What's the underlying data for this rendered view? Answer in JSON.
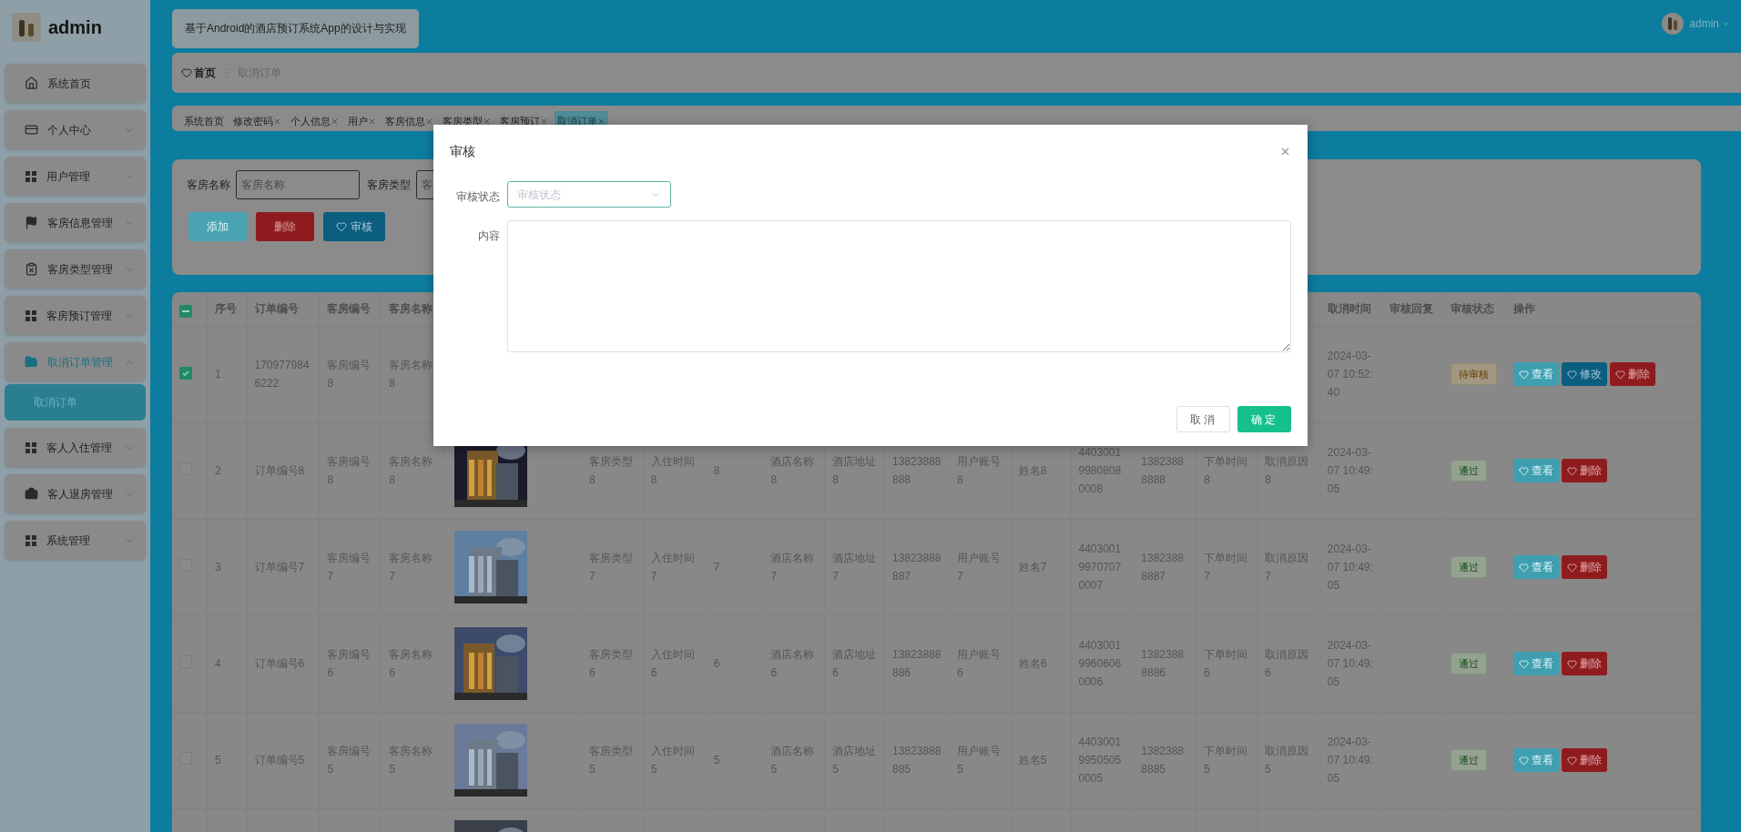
{
  "sidebar": {
    "title": "admin",
    "items": [
      {
        "label": "系统首页",
        "selected": false
      },
      {
        "label": "个人中心",
        "expanded": false,
        "selected": false
      },
      {
        "label": "用户管理",
        "expanded": false,
        "selected": false
      },
      {
        "label": "客房信息管理",
        "expanded": false,
        "selected": false
      },
      {
        "label": "客房类型管理",
        "expanded": false,
        "selected": false
      },
      {
        "label": "客房预订管理",
        "expanded": false,
        "selected": false
      },
      {
        "label": "取消订单管理",
        "expanded": true,
        "selected": true,
        "children": [
          {
            "label": "取消订单",
            "selected": true
          }
        ]
      },
      {
        "label": "客人入住管理",
        "expanded": false,
        "selected": false
      },
      {
        "label": "客人退房管理",
        "expanded": false,
        "selected": false
      },
      {
        "label": "系统管理",
        "expanded": false,
        "selected": false
      }
    ]
  },
  "header": {
    "title": "基于Android的酒店预订系统App的设计与实现",
    "user": "admin"
  },
  "breadcrumb": [
    "首页",
    "取消订单"
  ],
  "tabs": [
    {
      "label": "系统首页",
      "closable": false,
      "selected": false
    },
    {
      "label": "修改密码",
      "closable": true,
      "selected": false
    },
    {
      "label": "个人信息",
      "closable": true,
      "selected": false
    },
    {
      "label": "用户",
      "closable": true,
      "selected": false
    },
    {
      "label": "客房信息",
      "closable": true,
      "selected": false
    },
    {
      "label": "客房类型",
      "closable": true,
      "selected": false
    },
    {
      "label": "客房预订",
      "closable": true,
      "selected": false
    },
    {
      "label": "取消订单",
      "closable": true,
      "selected": true
    }
  ],
  "search": {
    "fields": [
      {
        "label": "客房名称",
        "placeholder": "客房名称"
      },
      {
        "label": "客房类型",
        "placeholder": "客"
      }
    ]
  },
  "toolbar": [
    {
      "label": "添加",
      "kind": "add"
    },
    {
      "label": "删除",
      "kind": "delete"
    },
    {
      "label": "审核",
      "kind": "review"
    }
  ],
  "table": {
    "select_all": {
      "indeterminate": true
    },
    "columns": {
      "index": "序号",
      "order_no": "订单编号",
      "room_no": "客房编号",
      "room_name": "客房名称",
      "cancel_time": "取消时间",
      "review_reply": "审核回复",
      "review_status": "审核状态",
      "actions": "操作"
    },
    "rows": [
      {
        "checked": true,
        "index": "1",
        "order_no": "1709779846222",
        "room_no": "客房编号8",
        "room_name": "客房名称8",
        "cancel_time": "2024-03-07 10:52:40",
        "status": {
          "label": "待审核",
          "kind": "pending"
        },
        "actions": [
          {
            "label": "查看",
            "kind": "view"
          },
          {
            "label": "修改",
            "kind": "edit"
          },
          {
            "label": "删除",
            "kind": "delete"
          }
        ]
      },
      {
        "checked": false,
        "index": "2",
        "order_no": "订单编号8",
        "room_no": "客房编号8",
        "room_name": "客房名称8",
        "photo": {
          "kind": "picture"
        },
        "room_type": "客房类型8",
        "checkin_time": "入住时间8",
        "column_8": "8",
        "hotel_name": "酒店名称8",
        "hotel_address": "酒店地址8",
        "phone": "13823888888",
        "user_account": "用户账号8",
        "name": "姓名8",
        "id_number": "440300199808080008",
        "user_phone": "13823888888",
        "order_time": "下单时间8",
        "cancel_reason": "取消原因8",
        "cancel_time": "2024-03-07 10:49:05",
        "status": {
          "label": "通过",
          "kind": "passed"
        },
        "actions": [
          {
            "label": "查看",
            "kind": "view"
          },
          {
            "label": "删除",
            "kind": "delete"
          }
        ]
      },
      {
        "checked": false,
        "index": "3",
        "order_no": "订单编号7",
        "room_no": "客房编号7",
        "room_name": "客房名称7",
        "photo": {
          "kind": "picture"
        },
        "room_type": "客房类型7",
        "checkin_time": "入住时间7",
        "column_8": "7",
        "hotel_name": "酒店名称7",
        "hotel_address": "酒店地址7",
        "phone": "13823888887",
        "user_account": "用户账号7",
        "name": "姓名7",
        "id_number": "440300199707070007",
        "user_phone": "13823888887",
        "order_time": "下单时间7",
        "cancel_reason": "取消原因7",
        "cancel_time": "2024-03-07 10:49:05",
        "status": {
          "label": "通过",
          "kind": "passed"
        },
        "actions": [
          {
            "label": "查看",
            "kind": "view"
          },
          {
            "label": "删除",
            "kind": "delete"
          }
        ]
      },
      {
        "checked": false,
        "index": "4",
        "order_no": "订单编号6",
        "room_no": "客房编号6",
        "room_name": "客房名称6",
        "photo": {
          "kind": "picture"
        },
        "room_type": "客房类型6",
        "checkin_time": "入住时间6",
        "column_8": "6",
        "hotel_name": "酒店名称6",
        "hotel_address": "酒店地址6",
        "phone": "13823888886",
        "user_account": "用户账号6",
        "name": "姓名6",
        "id_number": "440300199606060006",
        "user_phone": "13823888886",
        "order_time": "下单时间6",
        "cancel_reason": "取消原因6",
        "cancel_time": "2024-03-07 10:49:05",
        "status": {
          "label": "通过",
          "kind": "passed"
        },
        "actions": [
          {
            "label": "查看",
            "kind": "view"
          },
          {
            "label": "删除",
            "kind": "delete"
          }
        ]
      },
      {
        "checked": false,
        "index": "5",
        "order_no": "订单编号5",
        "room_no": "客房编号5",
        "room_name": "客房名称5",
        "photo": {
          "kind": "picture"
        },
        "room_type": "客房类型5",
        "checkin_time": "入住时间5",
        "column_8": "5",
        "hotel_name": "酒店名称5",
        "hotel_address": "酒店地址5",
        "phone": "13823888885",
        "user_account": "用户账号5",
        "name": "姓名5",
        "id_number": "440300199505050005",
        "user_phone": "13823888885",
        "order_time": "下单时间5",
        "cancel_reason": "取消原因5",
        "cancel_time": "2024-03-07 10:49:05",
        "status": {
          "label": "通过",
          "kind": "passed"
        },
        "actions": [
          {
            "label": "查看",
            "kind": "view"
          },
          {
            "label": "删除",
            "kind": "delete"
          }
        ]
      },
      {
        "photo": {
          "kind": "picture"
        }
      }
    ]
  },
  "dialog": {
    "title": "审核",
    "fields": [
      {
        "label": "审核状态",
        "kind": "select",
        "placeholder": "审核状态"
      },
      {
        "label": "内容",
        "kind": "textarea"
      }
    ],
    "buttons": [
      {
        "label": "取消",
        "kind": "cancel"
      },
      {
        "label": "确定",
        "kind": "confirm"
      }
    ]
  }
}
